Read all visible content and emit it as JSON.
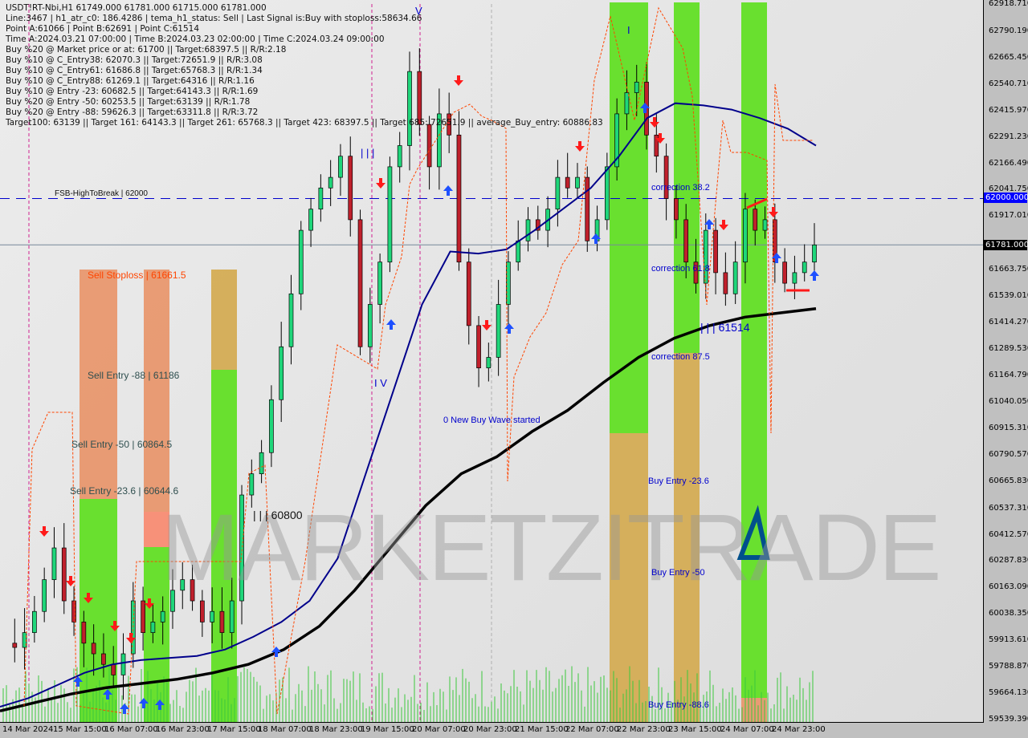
{
  "header": {
    "symbol_line": "USDT!RT-Nbi,H1  61749.000 61781.000 61715.000 61781.000",
    "lines": [
      "Line:3467 | h1_atr_c0: 186.4286 | tema_h1_status: Sell | Last Signal is:Buy with stoploss:58634.66",
      "Point A:61066 | Point B:62691 | Point C:61514",
      "Time A:2024.03.21 07:00:00 | Time B:2024.03.23 02:00:00 | Time C:2024.03.24 09:00:00",
      "Buy %20 @ Market price or at: 61700 || Target:68397.5 || R/R:2.18",
      "Buy %10 @ C_Entry38: 62070.3 || Target:72651.9 || R/R:3.08",
      "Buy %10 @ C_Entry61: 61686.8 || Target:65768.3 || R/R:1.34",
      "Buy %10 @ C_Entry88: 61269.1 || Target:64316 || R/R:1.16",
      "Buy %10 @ Entry -23: 60682.5 || Target:64143.3 || R/R:1.69",
      "Buy %20 @ Entry -50: 60253.5 || Target:63139 || R/R:1.78",
      "Buy %20 @ Entry -88: 59626.3 || Target:63311.8 || R/R:3.72",
      "Target100: 63139 || Target 161: 64143.3 || Target 261: 65768.3 || Target 423: 68397.5 || Target 685: 72651.9 || average_Buy_entry: 60886.83"
    ]
  },
  "watermark": "MARKETZITRADE",
  "badges": {
    "fsb_level": "62000.000",
    "current_price": "61781.000"
  },
  "colors": {
    "bull_candle": "#1fd67a",
    "bear_candle": "#c0202c",
    "ma_fast": "#00008b",
    "ma_slow": "#000000",
    "green_zone": "#5ee01f",
    "orange_zone": "#e8956a",
    "gold_zone": "#d4aa50",
    "fsb_line": "#0000cc",
    "signal_dash": "#ff4500",
    "volume": "#3cc83c"
  },
  "annotations": {
    "fsb": "FSB-HighToBreak | 62000",
    "sell_stoploss": "Sell Stoploss | 61661.5",
    "sell_entry_88": "Sell Entry -88 | 61186",
    "sell_entry_50": "Sell Entry -50 | 60864.5",
    "sell_entry_23": "Sell Entry -23.6 | 60644.6",
    "level_60800": "| | | 60800",
    "new_buy_wave": "0 New Buy Wave started",
    "correction_382": "correction 38.2",
    "correction_618": "correction 61.8",
    "correction_875": "correction 87.5",
    "level_61514": "| | | 61514",
    "buy_entry_236": "Buy Entry -23.6",
    "buy_entry_50": "Buy Entry -50",
    "buy_entry_886": "Buy Entry -88.6",
    "wave_iii": "| | |",
    "wave_iv": "I V",
    "wave_v": "V",
    "wave_i": "I"
  },
  "chart_data": {
    "type": "candlestick",
    "title": "USDT!RT-Nbi,H1",
    "xlabel": "",
    "ylabel": "",
    "ylim": [
      59539.39,
      62918.71
    ],
    "y_ticks": [
      "62918.710",
      "62790.190",
      "62665.450",
      "62540.710",
      "62415.970",
      "62291.230",
      "62166.490",
      "62041.750",
      "61917.010",
      "61663.750",
      "61539.010",
      "61414.270",
      "61289.530",
      "61164.790",
      "61040.050",
      "60915.310",
      "60790.570",
      "60665.830",
      "60537.310",
      "60412.570",
      "60287.830",
      "60163.090",
      "60038.350",
      "59913.610",
      "59788.870",
      "59664.130",
      "59539.390"
    ],
    "x_ticks": [
      "14 Mar 2024",
      "15 Mar 15:00",
      "16 Mar 07:00",
      "16 Mar 23:00",
      "17 Mar 15:00",
      "18 Mar 07:00",
      "18 Mar 23:00",
      "19 Mar 15:00",
      "20 Mar 07:00",
      "20 Mar 23:00",
      "21 Mar 15:00",
      "22 Mar 07:00",
      "22 Mar 23:00",
      "23 Mar 15:00",
      "24 Mar 07:00",
      "24 Mar 23:00"
    ],
    "horizontal_lines": [
      {
        "name": "FSB-HighToBreak",
        "value": 62000,
        "style": "dashed"
      },
      {
        "name": "current price",
        "value": 61781,
        "style": "solid"
      }
    ],
    "ohlc_last": {
      "open": 61749,
      "high": 61781,
      "low": 61715,
      "close": 61781
    },
    "price_path": [
      59900,
      59880,
      59950,
      60050,
      60200,
      60350,
      60100,
      60000,
      59900,
      59850,
      59800,
      59750,
      59850,
      60100,
      59950,
      60000,
      60050,
      60150,
      60200,
      60100,
      60000,
      60050,
      59950,
      60100,
      60600,
      60700,
      60800,
      61050,
      61300,
      61550,
      61850,
      61950,
      62050,
      62100,
      62200,
      61900,
      61300,
      61500,
      61700,
      62150,
      62250,
      62600,
      62350,
      62150,
      62400,
      62300,
      61700,
      61400,
      61200,
      61250,
      61500,
      61700,
      61800,
      61900,
      61850,
      61950,
      62100,
      62050,
      62100,
      61800,
      61900,
      62150,
      62400,
      62500,
      62550,
      62300,
      62200,
      62000,
      61900,
      61700,
      61600,
      61850,
      61650,
      61550,
      61700,
      61950,
      61850,
      61900,
      61700,
      61600,
      61650,
      61700,
      61781
    ],
    "ma_fast_path": [
      59600,
      59640,
      59700,
      59760,
      59800,
      59820,
      59830,
      59840,
      59870,
      59930,
      60000,
      60100,
      60300,
      60700,
      61100,
      61500,
      61750,
      61740,
      61760,
      61850,
      61950,
      62050,
      62200,
      62380,
      62450,
      62440,
      62420,
      62380,
      62330,
      62250
    ],
    "ma_slow_path": [
      59580,
      59620,
      59660,
      59690,
      59710,
      59730,
      59760,
      59800,
      59870,
      59980,
      60150,
      60350,
      60550,
      60700,
      60780,
      60900,
      61000,
      61130,
      61250,
      61340,
      61400,
      61440,
      61460,
      61480
    ]
  }
}
